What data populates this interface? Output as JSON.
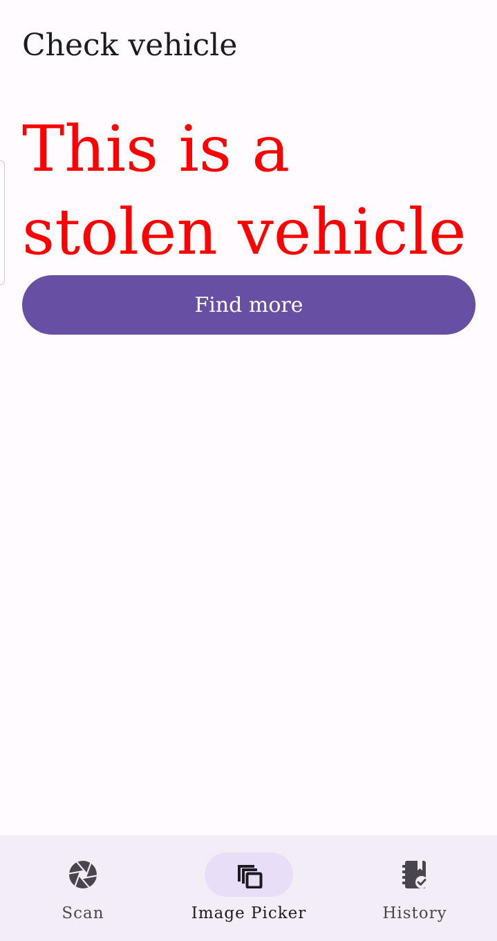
{
  "app_bar": {
    "title": "Check vehicle"
  },
  "result": {
    "message": "This is a stolen vehicle",
    "message_color": "#FF0000"
  },
  "actions": {
    "find_more_label": "Find more"
  },
  "bottom_nav": {
    "selected": "Image Picker",
    "items": [
      {
        "label": "Scan",
        "icon": "camera-shutter-icon"
      },
      {
        "label": "Image Picker",
        "icon": "image-picker-icon"
      },
      {
        "label": "History",
        "icon": "history-notebook-icon"
      }
    ]
  },
  "colors": {
    "background": "#FFFBFE",
    "primary": "#6750A4",
    "nav_background": "#F3EDF7",
    "nav_indicator": "#E8DEF8",
    "alert": "#FF0000"
  }
}
